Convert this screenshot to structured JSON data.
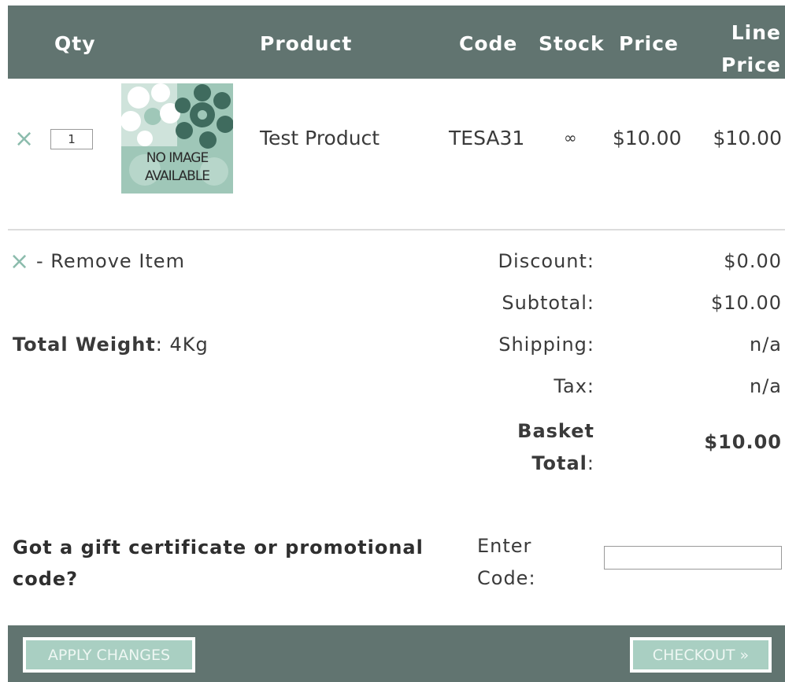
{
  "header": {
    "qty": "Qty",
    "product": "Product",
    "code": "Code",
    "stock": "Stock",
    "price": "Price",
    "line_price_1": "Line",
    "line_price_2": "Price"
  },
  "item": {
    "qty_value": "1",
    "image_text_1": "NO IMAGE",
    "image_text_2": "AVAILABLE",
    "product_name": "Test Product",
    "code": "TESA31",
    "stock": "∞",
    "price": "$10.00",
    "line_price": "$10.00",
    "remove_icon": "×"
  },
  "summary": {
    "remove_hint": "- Remove Item",
    "total_weight_label": "Total Weight",
    "total_weight_value": ": 4Kg",
    "discount_label": "Discount:",
    "discount_value": "$0.00",
    "subtotal_label": "Subtotal:",
    "subtotal_value": "$10.00",
    "shipping_label": "Shipping:",
    "shipping_value": "n/a",
    "tax_label": "Tax:",
    "tax_value": "n/a",
    "basket_total_label_1": "Basket",
    "basket_total_label_2": "Total",
    "basket_total_colon": ":",
    "basket_total_value": "$10.00"
  },
  "promo": {
    "question": "Got a gift certificate or promotional code?",
    "enter_code_label": "Enter Code:",
    "code_value": ""
  },
  "footer": {
    "apply_changes": "APPLY CHANGES",
    "checkout": "CHECKOUT »"
  },
  "colors": {
    "header_bg": "#617470",
    "accent_green": "#8cbcad",
    "button_bg": "#a9cfc2"
  },
  "icons": {
    "remove": "close-icon",
    "no_image": "no-image-placeholder-icon"
  }
}
